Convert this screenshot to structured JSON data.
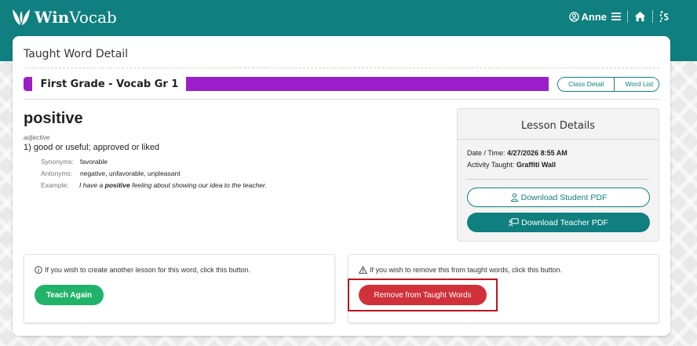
{
  "app": {
    "name_bold": "Win",
    "name_rest": "Vocab"
  },
  "nav": {
    "user_name": "Anne"
  },
  "page": {
    "title": "Taught Word Detail"
  },
  "grade": {
    "label": "First Grade - Vocab Gr 1",
    "accent_color": "#9b1fc8",
    "links": [
      "Class Detail",
      "Word List"
    ]
  },
  "word": {
    "term": "positive",
    "part_of_speech": "adjective",
    "definition": "1) good or useful; approved or liked",
    "synonyms_label": "Synonyms:",
    "synonyms": "favorable",
    "antonyms_label": "Antonyms:",
    "antonyms": "negative, unfavorable, unpleasant",
    "example_label": "Example:",
    "example_before": "I have a",
    "example_word": "positive",
    "example_after": "feeling about showing our idea to the teacher."
  },
  "lesson": {
    "title": "Lesson Details",
    "date_label": "Date / Time:",
    "date_value": "4/27/2026 8:55 AM",
    "activity_label": "Activity Taught:",
    "activity_value": "Graffiti Wall",
    "student_pdf_label": "Download Student PDF",
    "teacher_pdf_label": "Download Teacher PDF"
  },
  "actions": {
    "teach_message": "If you wish to create another lesson for this word, click this button.",
    "teach_button": "Teach Again",
    "remove_message": "If you wish to remove this from taught words, click this button.",
    "remove_button": "Remove from Taught Words"
  },
  "colors": {
    "brand_teal": "#0f7f7f",
    "teach_green": "#21b36a",
    "remove_red": "#d0313a",
    "highlight_red": "#c1121f"
  },
  "icons": [
    "logo-leaf-icon",
    "user-icon",
    "menu-icon",
    "home-icon",
    "sparkle-icon",
    "info-icon",
    "warning-icon",
    "student-pdf-icon",
    "teacher-pdf-icon"
  ]
}
